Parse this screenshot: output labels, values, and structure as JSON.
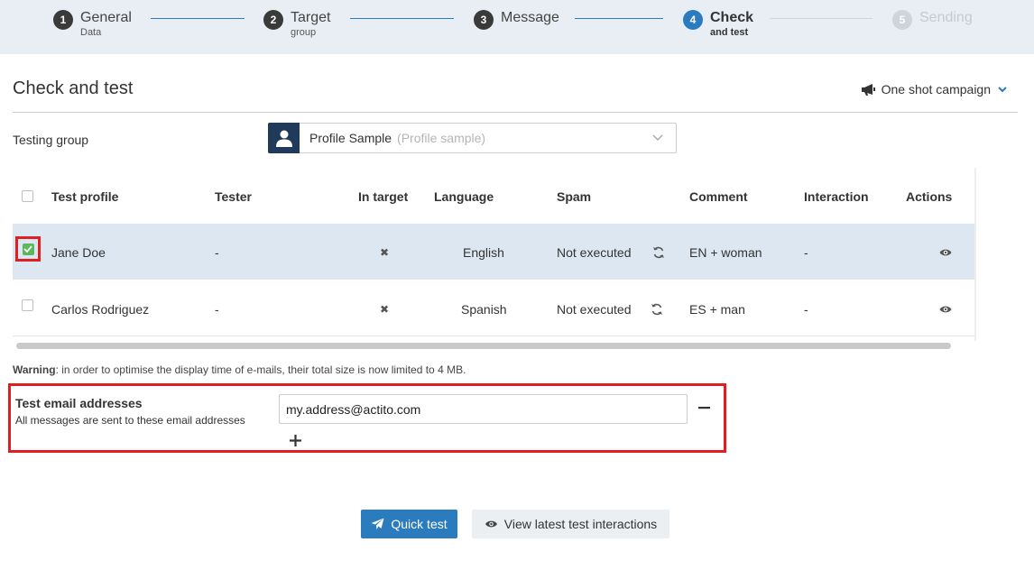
{
  "stepper": {
    "steps": [
      {
        "num": "1",
        "title": "General",
        "sub": "Data"
      },
      {
        "num": "2",
        "title": "Target",
        "sub": "group"
      },
      {
        "num": "3",
        "title": "Message",
        "sub": ""
      },
      {
        "num": "4",
        "title": "Check",
        "sub": "and test"
      },
      {
        "num": "5",
        "title": "Sending",
        "sub": ""
      }
    ],
    "active_index": 4
  },
  "page": {
    "title": "Check and test",
    "campaign_type": "One shot campaign"
  },
  "testing_group": {
    "label": "Testing group",
    "selected": "Profile Sample",
    "selected_sub": "(Profile sample)"
  },
  "table": {
    "headers": {
      "test_profile": "Test profile",
      "tester": "Tester",
      "in_target": "In target",
      "language": "Language",
      "spam": "Spam",
      "comment": "Comment",
      "interaction": "Interaction",
      "actions": "Actions"
    },
    "rows": [
      {
        "checked": true,
        "name": "Jane Doe",
        "tester": "-",
        "in_target": "✖",
        "language": "English",
        "spam": "Not executed",
        "comment": "EN + woman",
        "interaction": "-"
      },
      {
        "checked": false,
        "name": "Carlos Rodriguez",
        "tester": "-",
        "in_target": "✖",
        "language": "Spanish",
        "spam": "Not executed",
        "comment": "ES + man",
        "interaction": "-"
      }
    ]
  },
  "warning": {
    "label": "Warning",
    "text": ": in order to optimise the display time of e-mails, their total size is now limited to 4 MB."
  },
  "test_email": {
    "title": "Test email addresses",
    "subtitle": "All messages are sent to these email addresses",
    "value": "my.address@actito.com"
  },
  "buttons": {
    "quick_test": "Quick test",
    "view_latest": "View latest test interactions"
  },
  "colors": {
    "accent": "#2b7bbf",
    "highlight": "#e02020",
    "selected_row": "#dce7f2",
    "check_green": "#5cb85c"
  }
}
